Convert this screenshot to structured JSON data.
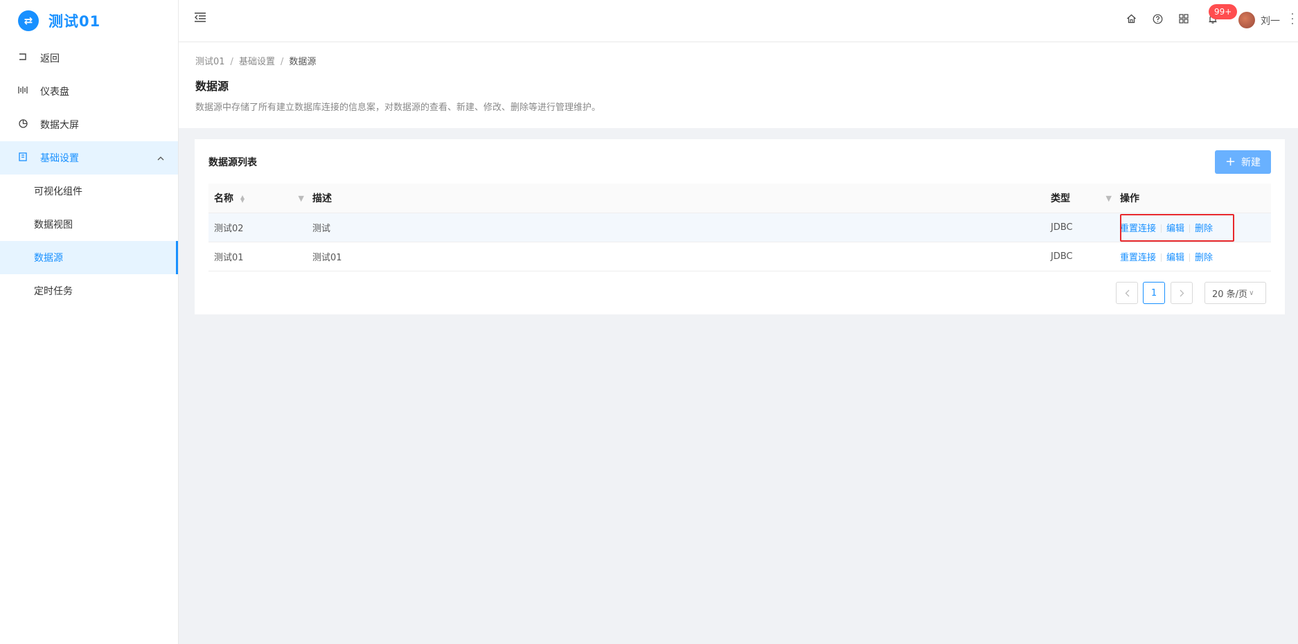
{
  "app": {
    "logo_icon": "⇄",
    "title": "测试01"
  },
  "sidebar": {
    "items": [
      {
        "icon": "return-icon",
        "label": "返回"
      },
      {
        "icon": "dashboard-icon",
        "label": "仪表盘"
      },
      {
        "icon": "pie-chart-icon",
        "label": "数据大屏"
      },
      {
        "icon": "book-icon",
        "label": "基础设置"
      }
    ],
    "subitems": [
      {
        "label": "可视化组件"
      },
      {
        "label": "数据视图"
      },
      {
        "label": "数据源"
      },
      {
        "label": "定时任务"
      }
    ]
  },
  "header": {
    "badge": "99+",
    "username": "刘一"
  },
  "breadcrumb": [
    "测试01",
    "基础设置",
    "数据源"
  ],
  "page": {
    "title": "数据源",
    "description": "数据源中存储了所有建立数据库连接的信息案，对数据源的查看、新建、修改、删除等进行管理维护。"
  },
  "card": {
    "title": "数据源列表",
    "new_button": "新建"
  },
  "table": {
    "columns": [
      "名称",
      "描述",
      "类型",
      "操作"
    ],
    "rows": [
      {
        "name": "测试02",
        "desc": "测试",
        "type": "JDBC"
      },
      {
        "name": "测试01",
        "desc": "测试01",
        "type": "JDBC"
      }
    ],
    "actions": {
      "reset": "重置连接",
      "edit": "编辑",
      "delete": "删除"
    }
  },
  "pagination": {
    "current": "1",
    "page_size": "20 条/页"
  },
  "colors": {
    "primary": "#1890ff",
    "highlight": "#e8282c",
    "badge": "#ff4d4f"
  }
}
